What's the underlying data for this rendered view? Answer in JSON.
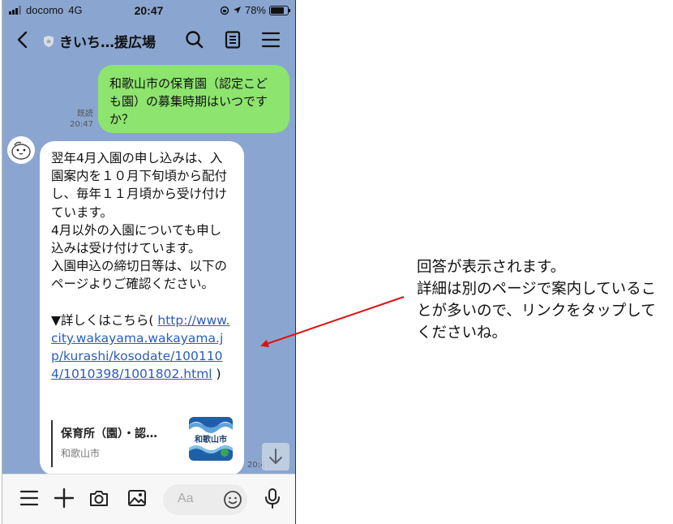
{
  "status_bar": {
    "carrier": "docomo",
    "network": "4G",
    "time": "20:47",
    "battery": "78%",
    "battery_level": 0.78
  },
  "header": {
    "title": "きいち…援広場"
  },
  "messages": {
    "user_message": "和歌山市の保育園（認定こども園）の募集時期はいつですか？",
    "read_label": "既読",
    "user_time": "20:47",
    "bot_text": "翌年4月入園の申し込みは、入園案内を１０月下旬頃から配付し、毎年１１月頃から受け付けています。\n4月以外の入園についても申し込みは受け付けています。\n入園申込の締切日等は、以下のページよりご確認ください。\n\n▼詳しくはこちら( ",
    "bot_link": "http://www.city.wakayama.wakayama.jp/kurashi/kosodate/1001104/1010398/1001802.html",
    "bot_link_close": " )",
    "card_title": "保育所（園）・認…",
    "card_source": "和歌山市",
    "card_thumb_text": "和歌山市",
    "bot_time": "20:47"
  },
  "input": {
    "placeholder": "Aa"
  },
  "annotation": {
    "text": "回答が表示されます。\n詳細は別のページで案内していることが多いので、リンクをタップしてくださいね。"
  },
  "colors": {
    "chat_background": "#8aa6d0",
    "user_bubble": "#8de46f",
    "link": "#2b5db8",
    "arrow": "#e01010"
  },
  "icons": {
    "back": "chevron-left-icon",
    "search": "search-icon",
    "notes": "notes-icon",
    "menu": "menu-icon",
    "plus": "plus-icon",
    "camera": "camera-icon",
    "image": "image-icon",
    "emoji": "emoji-icon",
    "mic": "microphone-icon",
    "scroll_down": "arrow-down-icon"
  }
}
